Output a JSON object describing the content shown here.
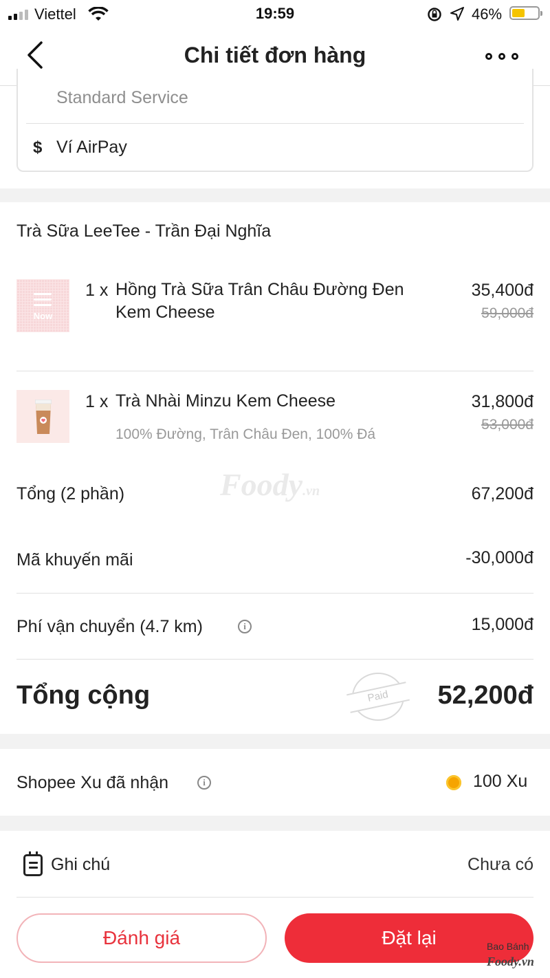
{
  "status_bar": {
    "carrier": "Viettel",
    "time": "19:59",
    "battery_percent": "46%"
  },
  "header": {
    "title": "Chi tiết đơn hàng"
  },
  "delivery": {
    "service": "Standard Service",
    "payment_symbol": "$",
    "payment_method": "Ví AirPay"
  },
  "shop": {
    "name": "Trà Sữa LeeTee - Trần Đại Nghĩa"
  },
  "items": [
    {
      "qty": "1 x",
      "name_line1": "Hồng Trà Sữa Trân Châu Đường Đen",
      "name_line2": "Kem Cheese",
      "price": "35,400đ",
      "original_price": "59,000đ",
      "thumb_label": "Now"
    },
    {
      "qty": "1 x",
      "name_line1": "Trà Nhài Minzu Kem Cheese",
      "options": "100% Đường, Trân Châu Đen, 100% Đá",
      "price": "31,800đ",
      "original_price": "53,000đ"
    }
  ],
  "summary": {
    "subtotal_label": "Tổng (2 phần)",
    "subtotal_value": "67,200đ",
    "promo_label": "Mã khuyến mãi",
    "promo_value": "-30,000đ",
    "shipping_label": "Phí vận chuyển (4.7 km)",
    "shipping_value": "15,000đ",
    "total_label": "Tổng cộng",
    "total_value": "52,200đ",
    "paid_stamp": "Paid"
  },
  "rewards": {
    "label": "Shopee Xu đã nhận",
    "value": "100 Xu"
  },
  "note": {
    "label": "Ghi chú",
    "value": "Chưa có"
  },
  "actions": {
    "rate_label": "Đánh giá",
    "reorder_label": "Đặt lại"
  },
  "watermark": {
    "brand": "Foody",
    "suffix": ".vn",
    "corner_text": "Bao Bánh",
    "corner_brand": "Foody.vn"
  },
  "colors": {
    "accent": "#ee2d39",
    "coin": "#f6a400",
    "battery": "#f5c400"
  }
}
